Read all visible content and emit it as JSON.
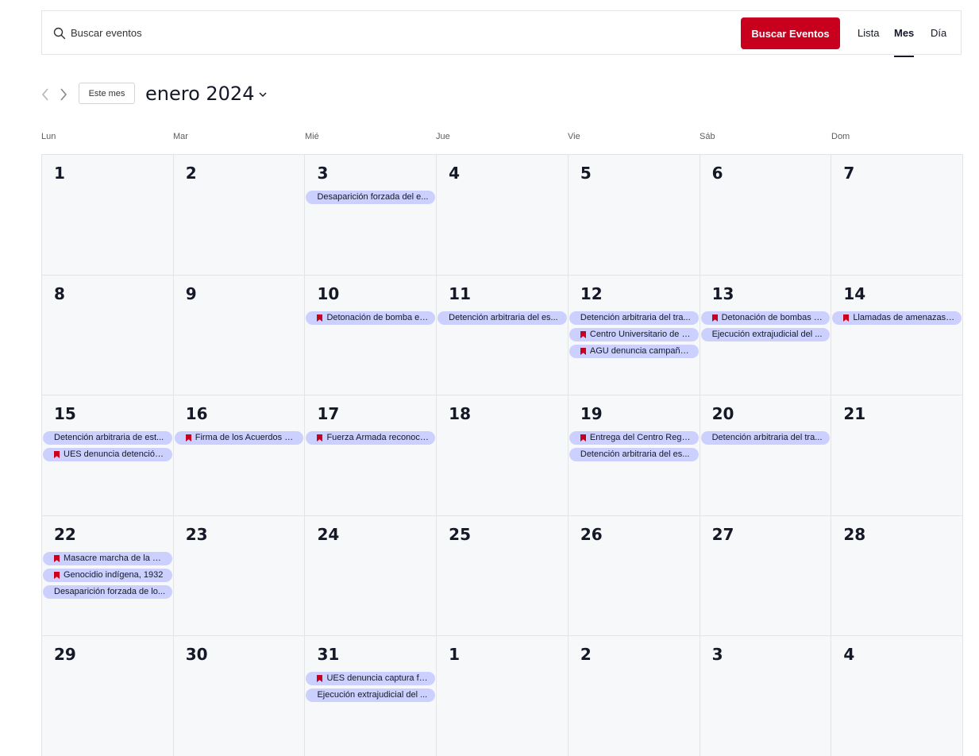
{
  "search": {
    "placeholder": "Buscar eventos",
    "button_label": "Buscar Eventos",
    "icon": "search-icon"
  },
  "views": [
    {
      "label": "Lista",
      "active": false
    },
    {
      "label": "Mes",
      "active": true
    },
    {
      "label": "Día",
      "active": false
    }
  ],
  "nav": {
    "today_label": "Este mes",
    "month_title": "enero 2024"
  },
  "weekdays": [
    "Lun",
    "Mar",
    "Mié",
    "Jue",
    "Vie",
    "Sáb",
    "Dom"
  ],
  "colors": {
    "accent": "#c8001e",
    "event_bg": "#ccd0ff",
    "cell_bg": "#f7f8f9"
  },
  "weeks": [
    [
      {
        "num": "1",
        "events": []
      },
      {
        "num": "2",
        "events": []
      },
      {
        "num": "3",
        "events": [
          {
            "title": "Desaparición forzada del e...",
            "featured": false
          }
        ]
      },
      {
        "num": "4",
        "events": []
      },
      {
        "num": "5",
        "events": []
      },
      {
        "num": "6",
        "events": []
      },
      {
        "num": "7",
        "events": []
      }
    ],
    [
      {
        "num": "8",
        "events": []
      },
      {
        "num": "9",
        "events": []
      },
      {
        "num": "10",
        "events": [
          {
            "title": "Detonación de bomba en ...",
            "featured": true
          }
        ]
      },
      {
        "num": "11",
        "events": [
          {
            "title": "Detención arbitraria del es...",
            "featured": false
          }
        ]
      },
      {
        "num": "12",
        "events": [
          {
            "title": "Detención arbitraria del tra...",
            "featured": false
          },
          {
            "title": "Centro Universitario de Oc...",
            "featured": true
          },
          {
            "title": "AGU denuncia campaña d...",
            "featured": true
          }
        ]
      },
      {
        "num": "13",
        "events": [
          {
            "title": "Detonación de bombas en...",
            "featured": true
          },
          {
            "title": "Ejecución extrajudicial del ...",
            "featured": false
          }
        ]
      },
      {
        "num": "14",
        "events": [
          {
            "title": "Llamadas de amenazas a ...",
            "featured": true
          }
        ]
      }
    ],
    [
      {
        "num": "15",
        "events": [
          {
            "title": "Detención arbitraria de est...",
            "featured": false
          },
          {
            "title": "UES denuncia detención ar...",
            "featured": true
          }
        ]
      },
      {
        "num": "16",
        "events": [
          {
            "title": "Firma de los Acuerdos de ...",
            "featured": true
          }
        ]
      },
      {
        "num": "17",
        "events": [
          {
            "title": "Fuerza Armada reconoce c...",
            "featured": true
          }
        ]
      },
      {
        "num": "18",
        "events": []
      },
      {
        "num": "19",
        "events": [
          {
            "title": "Entrega del Centro Region...",
            "featured": true
          },
          {
            "title": "Detención arbitraria del es...",
            "featured": false
          }
        ]
      },
      {
        "num": "20",
        "events": [
          {
            "title": "Detención arbitraria del tra...",
            "featured": false
          }
        ]
      },
      {
        "num": "21",
        "events": []
      }
    ],
    [
      {
        "num": "22",
        "events": [
          {
            "title": "Masacre marcha de la unid...",
            "featured": true
          },
          {
            "title": "Genocidio indígena, 1932",
            "featured": true
          },
          {
            "title": "Desaparición forzada de lo...",
            "featured": false
          }
        ]
      },
      {
        "num": "23",
        "events": []
      },
      {
        "num": "24",
        "events": []
      },
      {
        "num": "25",
        "events": []
      },
      {
        "num": "26",
        "events": []
      },
      {
        "num": "27",
        "events": []
      },
      {
        "num": "28",
        "events": []
      }
    ],
    [
      {
        "num": "29",
        "events": []
      },
      {
        "num": "30",
        "events": []
      },
      {
        "num": "31",
        "events": [
          {
            "title": "UES denuncia captura fren...",
            "featured": true
          },
          {
            "title": "Ejecución extrajudicial del ...",
            "featured": false
          }
        ]
      },
      {
        "num": "1",
        "events": []
      },
      {
        "num": "2",
        "events": []
      },
      {
        "num": "3",
        "events": []
      },
      {
        "num": "4",
        "events": []
      }
    ]
  ]
}
